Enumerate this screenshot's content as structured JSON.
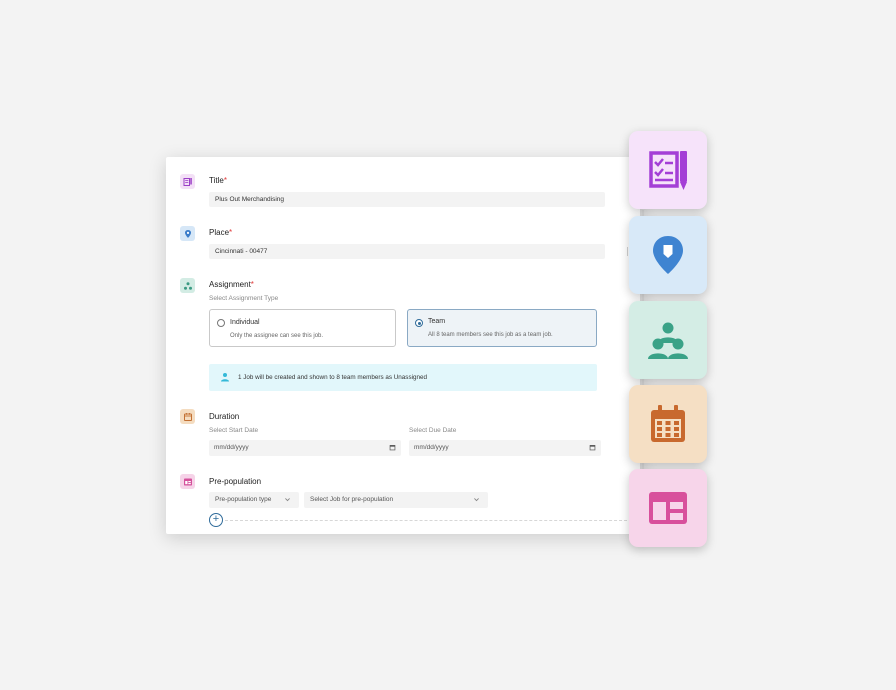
{
  "form": {
    "title": {
      "label": "Title",
      "required": "*",
      "value": "Plus Out Merchandising"
    },
    "place": {
      "label": "Place",
      "required": "*",
      "value": "Cincinnati - 00477"
    },
    "assignment": {
      "label": "Assignment",
      "required": "*",
      "subtitle": "Select Assignment Type",
      "options": [
        {
          "label": "Individual",
          "description": "Only the assignee can see this job.",
          "selected": false
        },
        {
          "label": "Team",
          "description": "All 8 team members see this job as a team job.",
          "selected": true
        }
      ],
      "info": "1 Job will be created and shown to 8 team members as Unassigned"
    },
    "duration": {
      "label": "Duration",
      "start_label": "Select Start Date",
      "start_placeholder": "mm/dd/yyyy",
      "due_label": "Select Due Date",
      "due_placeholder": "mm/dd/yyyy"
    },
    "prepopulation": {
      "label": "Pre-population",
      "type_placeholder": "Pre-population type",
      "job_placeholder": "Select Job for pre-population",
      "add_symbol": "+"
    }
  },
  "icons": {
    "title": "checklist-pen-icon",
    "place": "location-pin-icon",
    "assignment": "team-icon",
    "duration": "calendar-icon",
    "prepopulation": "layout-icon"
  },
  "colors": {
    "accent": "#2f6b9a",
    "required": "#e03a3a",
    "info_bg": "#e2f7fb",
    "tile_purple": "#f6e3fa",
    "tile_blue": "#d8e9f8",
    "tile_green": "#d4ede5",
    "tile_orange": "#f5dfc4",
    "tile_pink": "#f7d5ea"
  }
}
